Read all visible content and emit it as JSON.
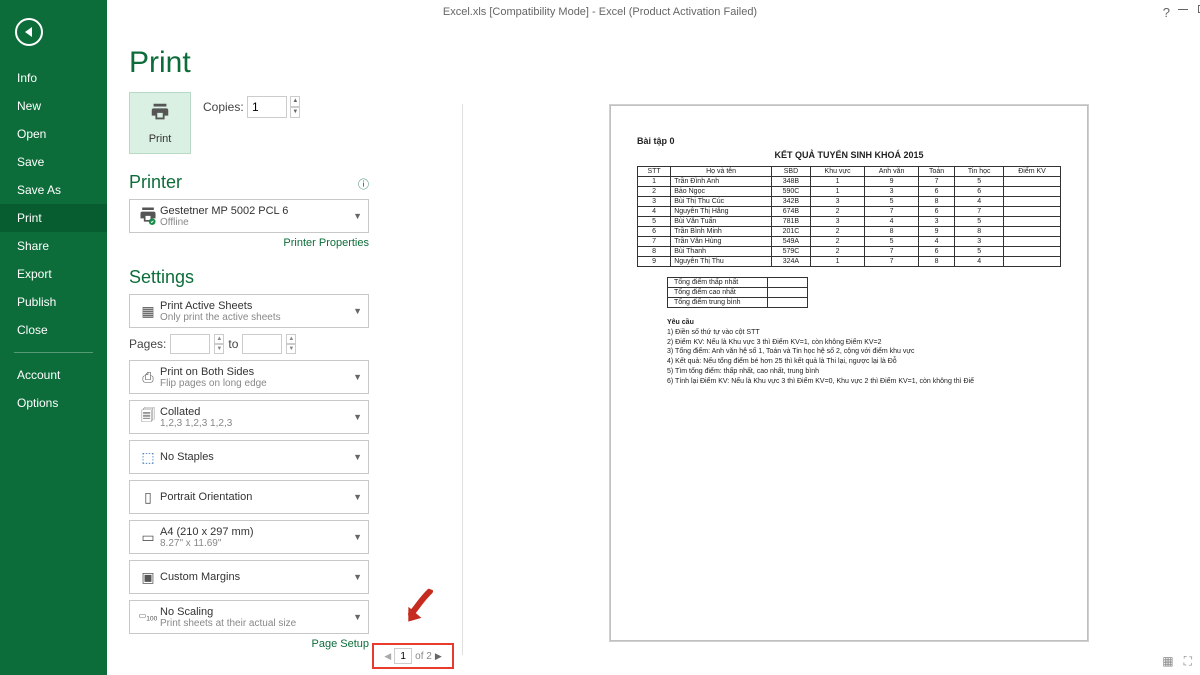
{
  "title": "Excel.xls  [Compatibility Mode] - Excel (Product Activation Failed)",
  "sidebar": [
    "Info",
    "New",
    "Open",
    "Save",
    "Save As",
    "Print",
    "Share",
    "Export",
    "Publish",
    "Close",
    "Account",
    "Options"
  ],
  "print": {
    "heading": "Print",
    "button": "Print",
    "copies_label": "Copies:",
    "copies_value": "1"
  },
  "printer": {
    "heading": "Printer",
    "name": "Gestetner MP 5002 PCL 6",
    "status": "Offline",
    "props_link": "Printer Properties"
  },
  "settings": {
    "heading": "Settings",
    "active_sheets": {
      "main": "Print Active Sheets",
      "sub": "Only print the active sheets"
    },
    "pages_label": "Pages:",
    "pages_to": "to",
    "both_sides": {
      "main": "Print on Both Sides",
      "sub": "Flip pages on long edge"
    },
    "collated": {
      "main": "Collated",
      "sub": "1,2,3   1,2,3   1,2,3"
    },
    "staples": {
      "main": "No Staples",
      "sub": ""
    },
    "orient": {
      "main": "Portrait Orientation",
      "sub": ""
    },
    "paper": {
      "main": "A4 (210 x 297 mm)",
      "sub": "8.27\" x 11.69\""
    },
    "margins": {
      "main": "Custom Margins",
      "sub": ""
    },
    "scaling": {
      "main": "No Scaling",
      "sub": "Print sheets at their actual size"
    },
    "page_setup": "Page Setup"
  },
  "preview": {
    "doc_title": "Bài tập 0",
    "heading": "KẾT QUẢ TUYỂN SINH KHOÁ 2015",
    "columns": [
      "STT",
      "Họ và tên",
      "SBD",
      "Khu vực",
      "Anh văn",
      "Toán",
      "Tin học",
      "Điểm KV"
    ],
    "rows": [
      [
        "1",
        "Trần Đình Anh",
        "348B",
        "1",
        "9",
        "7",
        "5",
        ""
      ],
      [
        "2",
        "Bảo Ngọc",
        "590C",
        "1",
        "3",
        "6",
        "6",
        ""
      ],
      [
        "3",
        "Bùi Thị Thu Cúc",
        "342B",
        "3",
        "5",
        "8",
        "4",
        ""
      ],
      [
        "4",
        "Nguyễn Thị Hằng",
        "674B",
        "2",
        "7",
        "6",
        "7",
        ""
      ],
      [
        "5",
        "Bùi Văn Tuấn",
        "781B",
        "3",
        "4",
        "3",
        "5",
        ""
      ],
      [
        "6",
        "Trần Bình Minh",
        "201C",
        "2",
        "8",
        "9",
        "8",
        ""
      ],
      [
        "7",
        "Trần Văn Hùng",
        "549A",
        "2",
        "5",
        "4",
        "3",
        ""
      ],
      [
        "8",
        "Bùi Thanh",
        "579C",
        "2",
        "7",
        "6",
        "5",
        ""
      ],
      [
        "9",
        "Nguyễn Thị Thu",
        "324A",
        "1",
        "7",
        "8",
        "4",
        ""
      ]
    ],
    "summary": [
      "Tổng điểm thấp nhất",
      "Tổng điểm cao nhất",
      "Tổng điểm trung bình"
    ],
    "notes_head": "Yêu cầu",
    "notes": [
      "1) Điền số thứ tự vào cột STT",
      "2) Điểm KV: Nếu là Khu vực 3 thì Điểm KV=1, còn không Điểm KV=2",
      "3) Tổng điểm: Anh văn hệ số 1, Toán và Tin học hệ số 2, cộng với điểm khu vực",
      "4) Kết quả: Nếu tổng điểm bé hơn 25 thì kết quả là Thi lại, ngược lại là Đỗ",
      "5) Tìm tổng điểm: thấp nhất, cao nhất, trung bình",
      "6) Tính lại Điểm KV: Nếu là Khu vực 3 thì Điểm KV=0, Khu vực 2 thì Điểm KV=1, còn không thì Điể"
    ]
  },
  "pagenav": {
    "current": "1",
    "total": "of 2"
  }
}
